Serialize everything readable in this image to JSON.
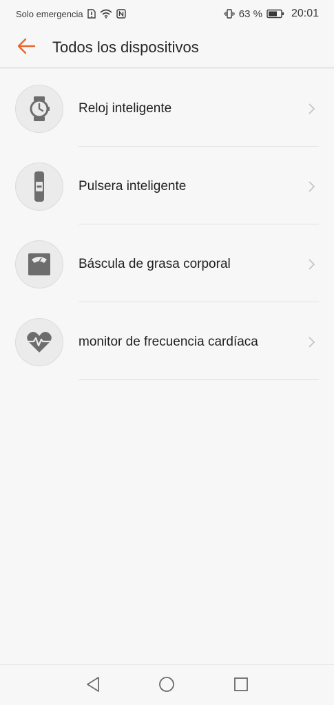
{
  "status_bar": {
    "carrier": "Solo emergencia",
    "battery_percent": "63 %",
    "time": "20:01",
    "icons": [
      "sim-alert-icon",
      "wifi-icon",
      "nfc-icon",
      "vibrate-icon",
      "battery-icon"
    ]
  },
  "app_bar": {
    "title": "Todos los dispositivos",
    "back_icon": "arrow-left-icon",
    "accent_color": "#e9652c"
  },
  "devices": [
    {
      "label": "Reloj inteligente",
      "icon": "smartwatch-icon"
    },
    {
      "label": "Pulsera inteligente",
      "icon": "smart-band-icon"
    },
    {
      "label": "Báscula de grasa corporal",
      "icon": "body-fat-scale-icon"
    },
    {
      "label": "monitor de frecuencia cardíaca",
      "icon": "heart-rate-monitor-icon"
    }
  ],
  "nav_bar": {
    "icons": [
      "back-triangle-icon",
      "home-circle-icon",
      "recents-square-icon"
    ]
  }
}
